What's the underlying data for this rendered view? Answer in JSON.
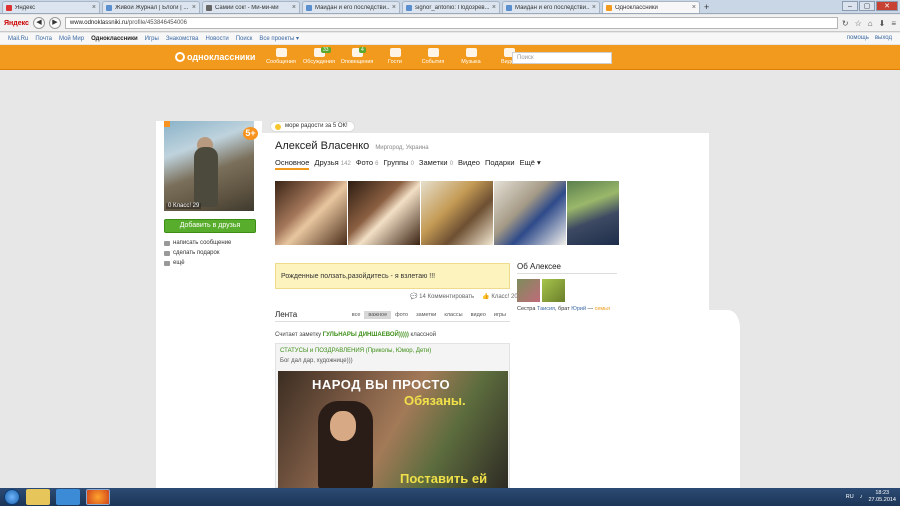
{
  "browser": {
    "tabs": [
      {
        "label": "Яндекс",
        "color": "#d33"
      },
      {
        "label": "Живой Журнал | Блоги | ...",
        "color": "#5a8fd0"
      },
      {
        "label": "Самий сок! - Ми-ми-ми",
        "color": "#666"
      },
      {
        "label": "Майдан и его последстви...",
        "color": "#5a8fd0"
      },
      {
        "label": "signor_antonio: Подозрев...",
        "color": "#5a8fd0"
      },
      {
        "label": "Майдан и его последстви...",
        "color": "#5a8fd0"
      },
      {
        "label": "Одноклассники",
        "color": "#f29a1d",
        "active": true
      }
    ],
    "new_tab": "+",
    "brand": "Яндекс",
    "url_host": "www.odnoklassniki.ru",
    "url_path": "/profile/453846454006"
  },
  "toplinks": {
    "items": [
      "Mail.Ru",
      "Почта",
      "Мой Мир",
      "Одноклассники",
      "Игры",
      "Знакомства",
      "Новости",
      "Поиск",
      "Все проекты ▾"
    ],
    "right": [
      "помощь",
      "выход"
    ]
  },
  "ok": {
    "logo": "одноклассники",
    "menu": [
      {
        "label": "Сообщения",
        "badge": ""
      },
      {
        "label": "Обсуждения",
        "badge": "33"
      },
      {
        "label": "Оповещения",
        "badge": "4"
      },
      {
        "label": "Гости",
        "badge": ""
      },
      {
        "label": "События",
        "badge": ""
      },
      {
        "label": "Музыка",
        "badge": ""
      },
      {
        "label": "Видео",
        "badge": ""
      }
    ],
    "search_placeholder": "Поиск"
  },
  "profile": {
    "five_badge": "5+",
    "photo_meta": "0  Класс! 29",
    "add_friend": "Добавить в друзья",
    "actions": [
      "написать сообщение",
      "сделать подарок",
      "ещё"
    ],
    "more_joy": "море радости за 5 ОК!",
    "name": "Алексей Власенко",
    "city": "Миргород, Украина",
    "tabs": [
      {
        "label": "Основное",
        "count": ""
      },
      {
        "label": "Друзья",
        "count": "142"
      },
      {
        "label": "Фото",
        "count": "6"
      },
      {
        "label": "Группы",
        "count": "0"
      },
      {
        "label": "Заметки",
        "count": "0"
      },
      {
        "label": "Видео",
        "count": ""
      },
      {
        "label": "Подарки",
        "count": ""
      },
      {
        "label": "Ещё ▾",
        "count": ""
      }
    ],
    "status_text": "Рожденные ползать,разойдитесь - я взлетаю !!!",
    "status_comments": "14 Комментировать",
    "status_likes": "Класс! 20",
    "about_title": "Об Алексее",
    "about_prefix": "Сестра",
    "about_sister": "Таисия",
    "about_mid": ", брат",
    "about_brother": "Юрий",
    "about_dash": " — ",
    "about_family": "семья"
  },
  "feed": {
    "title": "Лента",
    "tabs": [
      "все",
      "важное",
      "фото",
      "заметки",
      "классы",
      "видео",
      "игры"
    ],
    "selected_tab": "важное",
    "line_prefix": "Считает заметку",
    "line_author": "ГУЛЬНАРЫ ДИНШАЕВОЙ)))))",
    "line_suffix": "классной",
    "group": "СТАТУСЫ и ПОЗДРАВЛЕНИЯ (Приколы, Юмор, Дети)",
    "post_text": "Бог дал дар, художнице)))",
    "img_line1": "НАРОД ВЫ ПРОСТО",
    "img_line2": "Обязаны.",
    "img_line3": "Поставить ей"
  },
  "taskbar": {
    "lang": "RU",
    "time": "18:23",
    "date": "27.05.2014"
  }
}
